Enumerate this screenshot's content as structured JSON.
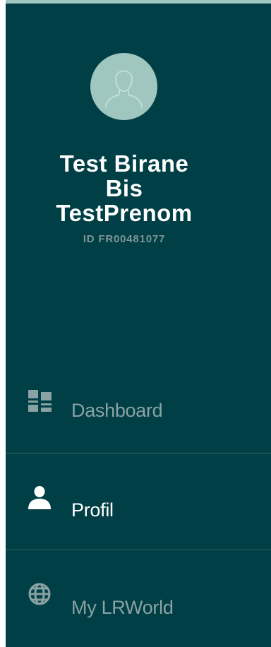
{
  "user": {
    "name_line1": "Test Birane",
    "name_line2": "Bis",
    "name_line3": "TestPrenom",
    "id": "ID FR00481077",
    "avatar_icon": "user-silhouette-icon"
  },
  "nav": {
    "items": [
      {
        "label": "Dashboard",
        "icon": "dashboard-icon",
        "state": "inactive"
      },
      {
        "label": "Profil",
        "icon": "user-icon",
        "state": "active"
      },
      {
        "label": "My LRWorld",
        "icon": "globe-icon",
        "state": "inactive"
      }
    ]
  },
  "colors": {
    "sidebar_bg": "#003f45",
    "accent": "#9fc6bf",
    "active_text": "#ffffff",
    "inactive_text": "#8aa2a4",
    "muted_text": "#7e9597"
  }
}
